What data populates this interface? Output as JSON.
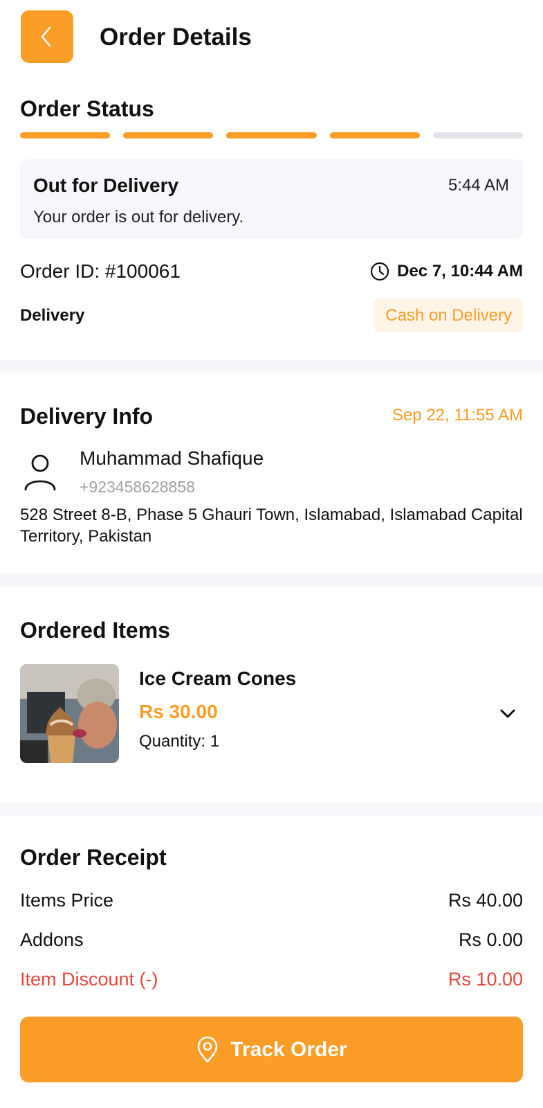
{
  "header": {
    "title": "Order Details",
    "back_icon": "chevron-left-icon"
  },
  "order_status": {
    "section_title": "Order Status",
    "progress_steps_completed": 4,
    "progress_steps_total": 5,
    "status_title": "Out for Delivery",
    "status_time": "5:44 AM",
    "status_description": "Your order is out for delivery."
  },
  "order": {
    "id_label": "Order ID: #100061",
    "date": "Dec 7, 10:44 AM",
    "delivery_type": "Delivery",
    "payment_method": "Cash on Delivery"
  },
  "delivery_info": {
    "section_title": "Delivery Info",
    "date": "Sep 22, 11:55 AM",
    "name": "Muhammad Shafique",
    "phone": "+923458628858",
    "address": "528 Street 8-B, Phase 5 Ghauri Town, Islamabad, Islamabad Capital Territory, Pakistan"
  },
  "ordered_items": {
    "section_title": "Ordered Items",
    "items": [
      {
        "name": "Ice Cream Cones",
        "price": "Rs 30.00",
        "quantity": "Quantity: 1"
      }
    ]
  },
  "receipt": {
    "section_title": "Order Receipt",
    "rows": [
      {
        "label": "Items Price",
        "value": "Rs 40.00"
      },
      {
        "label": "Addons",
        "value": "Rs 0.00"
      },
      {
        "label": "Item Discount (-)",
        "value": "Rs 10.00"
      }
    ]
  },
  "actions": {
    "track_order_label": "Track Order"
  },
  "colors": {
    "accent": "#fb9d27",
    "discount": "#e5463c",
    "muted": "#a0a0a0",
    "progress_inactive": "#e1e3e8",
    "section_divider": "#f4f6fa"
  }
}
